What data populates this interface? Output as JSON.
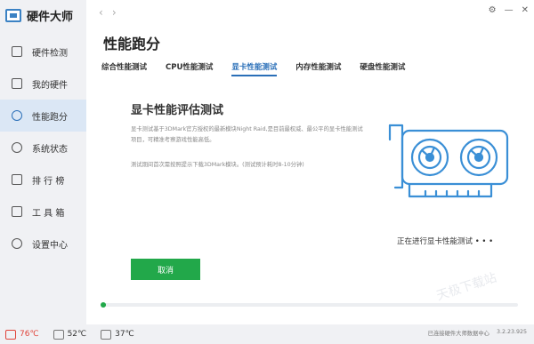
{
  "app": {
    "title": "硬件大师"
  },
  "sidebar": {
    "items": [
      {
        "label": "硬件检测",
        "icon": "monitor-icon",
        "active": false
      },
      {
        "label": "我的硬件",
        "icon": "card-icon",
        "active": false
      },
      {
        "label": "性能跑分",
        "icon": "gauge-icon",
        "active": true
      },
      {
        "label": "系统状态",
        "icon": "eye-icon",
        "active": false
      },
      {
        "label": "排 行 榜",
        "icon": "ranking-icon",
        "active": false
      },
      {
        "label": "工 具 箱",
        "icon": "toolbox-icon",
        "active": false
      },
      {
        "label": "设置中心",
        "icon": "gear-icon",
        "active": false
      }
    ]
  },
  "topbar": {
    "back": "‹",
    "forward": "›"
  },
  "window": {
    "settings": "⚙",
    "minimize": "—",
    "close": "✕"
  },
  "page": {
    "title": "性能跑分"
  },
  "tabs": [
    {
      "label": "综合性能测试",
      "active": false
    },
    {
      "label": "CPU性能测试",
      "active": false
    },
    {
      "label": "显卡性能测试",
      "active": true
    },
    {
      "label": "内存性能测试",
      "active": false
    },
    {
      "label": "硬盘性能测试",
      "active": false
    }
  ],
  "test": {
    "title": "显卡性能评估测试",
    "description": "显卡测试基于3DMark官方授权的最新模块Night Raid,是目前最权威、最公平的显卡性能测试项目，可精准考察游戏性能高低。",
    "note": "测试期间首次需按照提示下载3DMark模块。(测试预计耗时8-10分钟)",
    "status": "正在进行显卡性能测试 • • •",
    "cancel_label": "取消",
    "progress": 0.01
  },
  "watermark": "天极下载站",
  "statusbar": {
    "temps": [
      {
        "value": "76℃",
        "icon": "cpu-temp-icon",
        "warn": true
      },
      {
        "value": "52℃",
        "icon": "gpu-temp-icon",
        "warn": false
      },
      {
        "value": "37℃",
        "icon": "disk-temp-icon",
        "warn": false
      }
    ],
    "footer_note": "已连接硬件大师数据中心",
    "version": "3.2.23.925"
  },
  "colors": {
    "accent": "#2a6fb8",
    "green": "#22a84a",
    "warn": "#e0443a"
  }
}
